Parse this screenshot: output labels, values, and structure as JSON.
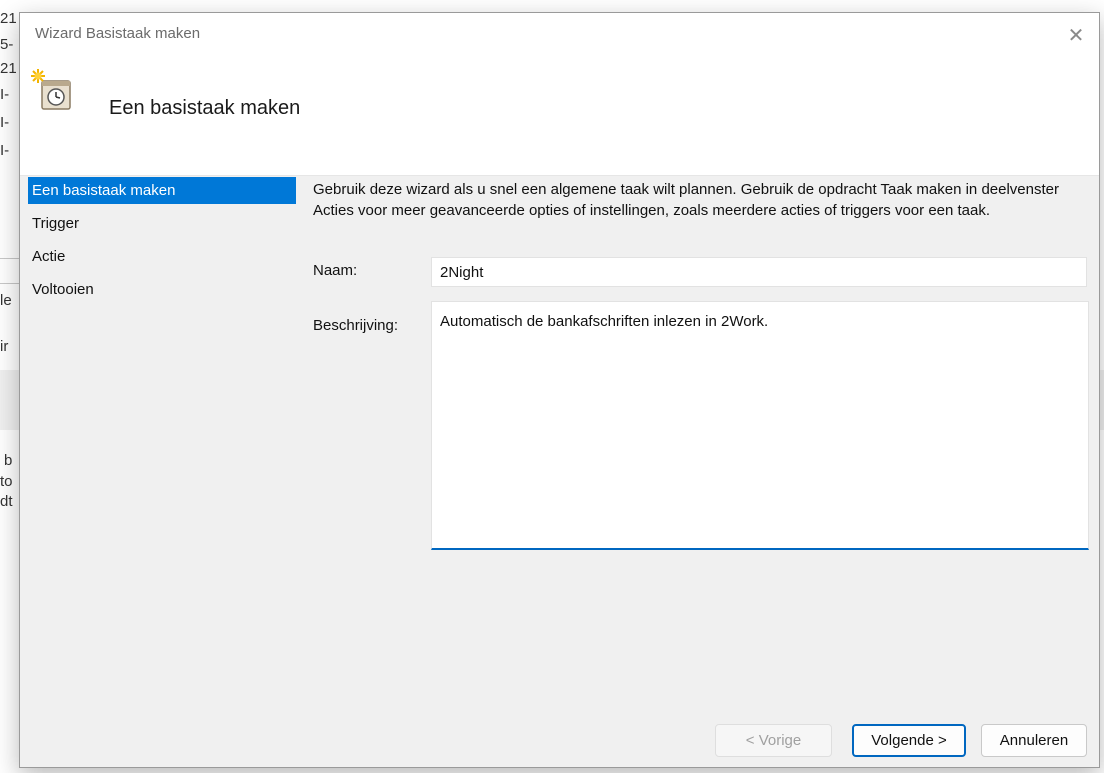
{
  "background": {
    "fragments": [
      {
        "text": "21"
      },
      {
        "text": "5-"
      },
      {
        "text": "21"
      },
      {
        "text": "I-"
      },
      {
        "text": "I-"
      },
      {
        "text": "I-"
      },
      {
        "text": "le"
      },
      {
        "text": "ir"
      },
      {
        "text": "b"
      },
      {
        "text": "to"
      },
      {
        "text": "dt"
      }
    ]
  },
  "dialog": {
    "title": "Wizard Basistaak maken",
    "close_glyph": "✕",
    "icon": "scheduled-task-clock-icon",
    "header_title": "Een basistaak maken"
  },
  "nav": {
    "items": [
      {
        "label": "Een basistaak maken",
        "active": true
      },
      {
        "label": "Trigger",
        "active": false
      },
      {
        "label": "Actie",
        "active": false
      },
      {
        "label": "Voltooien",
        "active": false
      }
    ]
  },
  "content": {
    "intro": "Gebruik deze wizard als u snel een algemene taak wilt plannen. Gebruik de opdracht Taak maken in deelvenster Acties voor meer geavanceerde opties of instellingen, zoals meerdere acties of triggers voor een taak.",
    "name_label": "Naam:",
    "name_value": "2Night",
    "description_label": "Beschrijving:",
    "description_value": "Automatisch de bankafschriften inlezen in 2Work."
  },
  "buttons": {
    "back": "< Vorige",
    "next": "Volgende >",
    "cancel": "Annuleren"
  },
  "colors": {
    "accent": "#0078d7",
    "focus": "#0067c0",
    "dialog_bg": "#f0f0f0"
  }
}
